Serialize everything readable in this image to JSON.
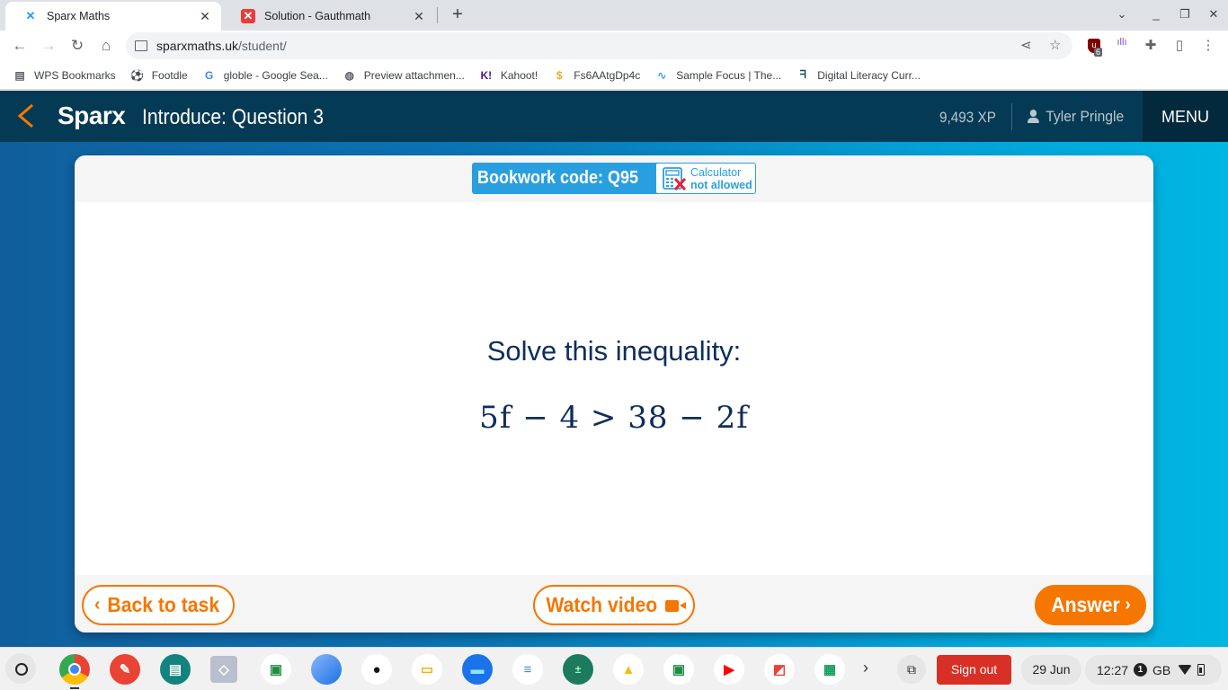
{
  "browser": {
    "tabs": [
      {
        "title": "Sparx Maths",
        "icon": "sparx-x-icon",
        "active": true
      },
      {
        "title": "Solution - Gauthmath",
        "icon": "gauthmath-icon",
        "active": false
      }
    ],
    "new_tab_label": "+",
    "url": {
      "host": "sparxmaths.uk",
      "path": "/student/"
    },
    "extension_badge": "6",
    "bookmarks": [
      {
        "label": "WPS Bookmarks",
        "icon": "folder-icon"
      },
      {
        "label": "Footdle",
        "icon": "football-icon"
      },
      {
        "label": "globle - Google Sea...",
        "icon": "google-icon"
      },
      {
        "label": "Preview attachmen...",
        "icon": "globe-icon"
      },
      {
        "label": "Kahoot!",
        "icon": "kahoot-icon"
      },
      {
        "label": "Fs6AAtgDp4c",
        "icon": "dollar-icon"
      },
      {
        "label": "Sample Focus | The...",
        "icon": "waveform-icon"
      },
      {
        "label": "Digital Literacy Curr...",
        "icon": "curriculum-icon"
      }
    ]
  },
  "app": {
    "logo": "Sparx",
    "title": "Introduce: Question 3",
    "xp": "9,493 XP",
    "user": "Tyler Pringle",
    "menu_label": "MENU",
    "accent": "#f57700",
    "header_bg": "#053a54"
  },
  "question": {
    "bookwork_code": "Bookwork code: Q95",
    "calculator_line1": "Calculator",
    "calculator_line2": "not allowed",
    "prompt": "Solve this inequality:",
    "equation": "5f − 4 > 38 − 2f"
  },
  "actions": {
    "back": "Back to task",
    "video": "Watch video",
    "answer": "Answer"
  },
  "shelf": {
    "apps": [
      {
        "name": "chrome",
        "color": "#4285f4"
      },
      {
        "name": "paint",
        "color": "#ea4335"
      },
      {
        "name": "screencast",
        "color": "#12837e"
      },
      {
        "name": "cube",
        "color": "#b9bfcc"
      },
      {
        "name": "classroom",
        "color": "#ffffff"
      },
      {
        "name": "earth",
        "color": "#3b82d6"
      },
      {
        "name": "panda",
        "color": "#ffffff"
      },
      {
        "name": "slides",
        "color": "#ffffff"
      },
      {
        "name": "files",
        "color": "#1a73e8"
      },
      {
        "name": "docs",
        "color": "#ffffff"
      },
      {
        "name": "calculator",
        "color": "#1b7b5c"
      },
      {
        "name": "drive",
        "color": "#ffffff"
      },
      {
        "name": "classroom-2",
        "color": "#ffffff"
      },
      {
        "name": "youtube",
        "color": "#ffffff"
      },
      {
        "name": "office",
        "color": "#ffffff"
      },
      {
        "name": "sheets",
        "color": "#ffffff"
      }
    ],
    "sign_out": "Sign out",
    "date": "29 Jun",
    "time": "12:27",
    "notification_count": "1",
    "ime": "GB"
  }
}
